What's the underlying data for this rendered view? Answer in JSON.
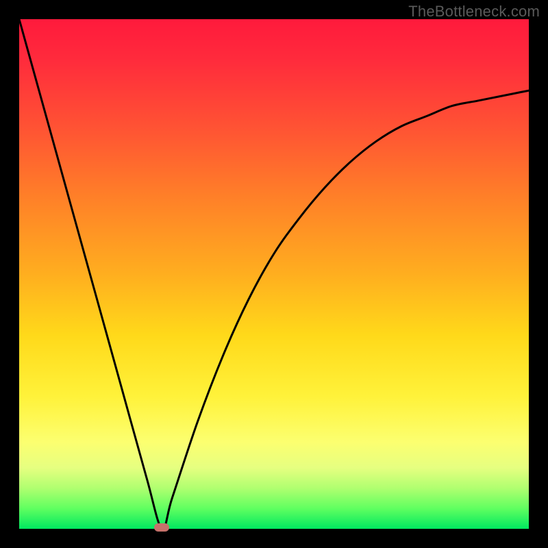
{
  "watermark": "TheBottleneck.com",
  "chart_data": {
    "type": "line",
    "title": "",
    "xlabel": "",
    "ylabel": "",
    "xlim": [
      0,
      100
    ],
    "ylim": [
      0,
      100
    ],
    "background_gradient": [
      "#ff1a3c",
      "#00e860"
    ],
    "series": [
      {
        "name": "curve",
        "x": [
          0,
          5,
          10,
          15,
          20,
          25,
          28,
          30,
          35,
          40,
          45,
          50,
          55,
          60,
          65,
          70,
          75,
          80,
          85,
          90,
          95,
          100
        ],
        "y": [
          100,
          82,
          64,
          46,
          28,
          10,
          0,
          6,
          21,
          34,
          45,
          54,
          61,
          67,
          72,
          76,
          79,
          81,
          83,
          84,
          85,
          86
        ]
      }
    ],
    "marker": {
      "x": 28,
      "y": 0,
      "color": "#c6716b"
    }
  }
}
